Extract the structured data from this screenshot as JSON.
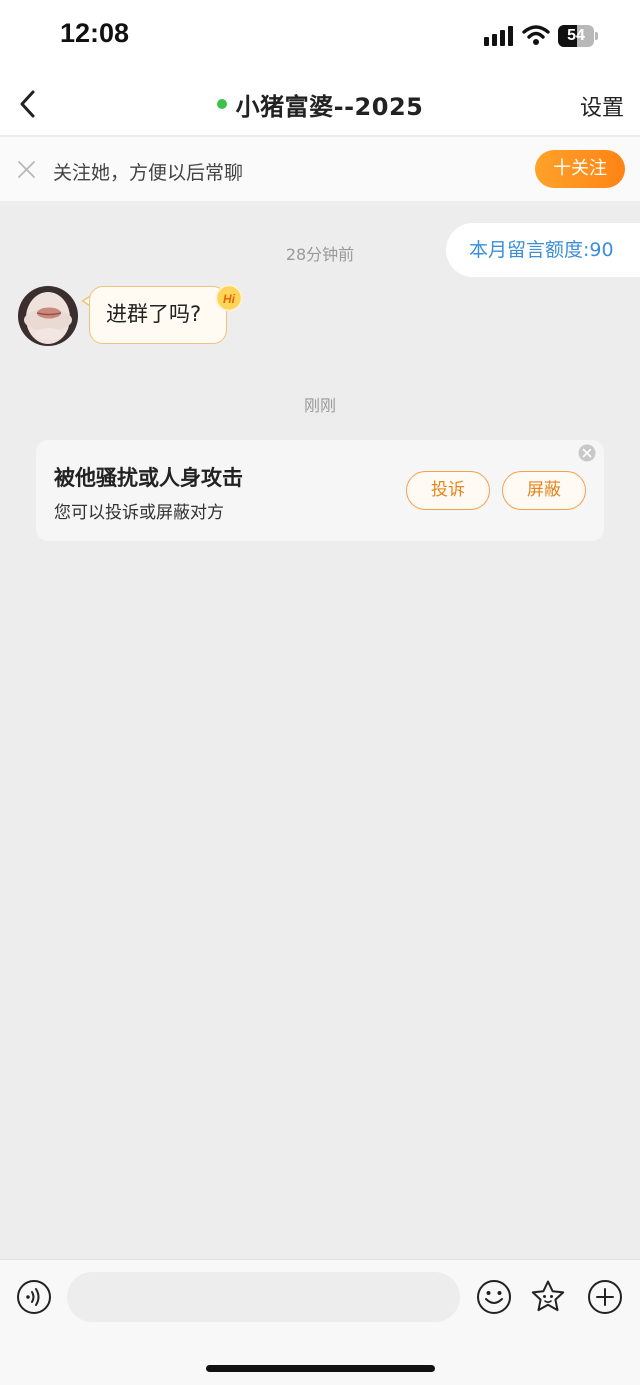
{
  "status_bar": {
    "time": "12:08",
    "battery_level": "54"
  },
  "nav": {
    "title": "小猪富婆--2025",
    "online": true,
    "settings_label": "设置"
  },
  "follow_banner": {
    "text": "关注她，方便以后常聊",
    "button_label": "十关注"
  },
  "chat": {
    "quota_label": "本月留言额度:90",
    "messages": [
      {
        "timestamp": "28分钟前",
        "text": "进群了吗?",
        "badge": "Hi"
      }
    ],
    "notice": {
      "timestamp": "刚刚",
      "title": "被他骚扰或人身攻击",
      "subtitle": "您可以投诉或屏蔽对方",
      "report_label": "投诉",
      "block_label": "屏蔽"
    }
  },
  "input_bar": {
    "placeholder": ""
  },
  "colors": {
    "accent": "#ff8414",
    "online": "#3cc24a",
    "quota_text": "#3d8ed8",
    "background": "#ededed"
  }
}
